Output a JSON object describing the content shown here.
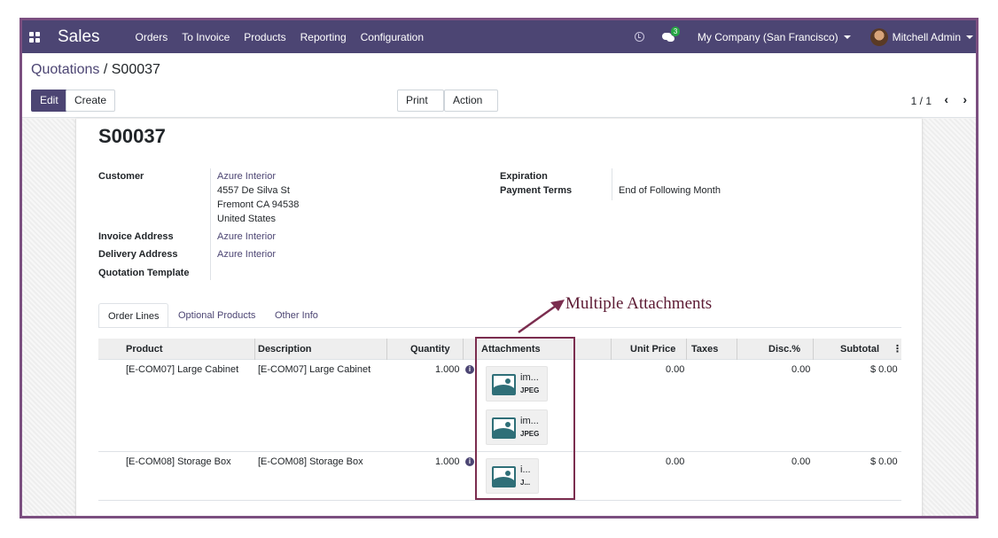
{
  "navbar": {
    "app_title": "Sales",
    "menu": [
      "Orders",
      "To Invoice",
      "Products",
      "Reporting",
      "Configuration"
    ],
    "chat_badge": "3",
    "company": "My Company (San Francisco)",
    "user": "Mitchell Admin",
    "background": "#4c4573"
  },
  "breadcrumb": {
    "parent": "Quotations",
    "separator": "/",
    "current": "S00037"
  },
  "buttons": {
    "edit": "Edit",
    "create": "Create",
    "print": "Print",
    "action": "Action"
  },
  "pager": {
    "text": "1 / 1"
  },
  "record": {
    "name": "S00037",
    "customer_label": "Customer",
    "customer_name": "Azure Interior",
    "address_line1": "4557 De Silva St",
    "address_line2": "Fremont CA 94538",
    "address_line3": "United States",
    "invoice_address_label": "Invoice Address",
    "invoice_address": "Azure Interior",
    "delivery_address_label": "Delivery Address",
    "delivery_address": "Azure Interior",
    "quotation_template_label": "Quotation Template",
    "expiration_label": "Expiration",
    "payment_terms_label": "Payment Terms",
    "payment_terms": "End of Following Month"
  },
  "tabs": [
    "Order Lines",
    "Optional Products",
    "Other Info"
  ],
  "table": {
    "headers": {
      "product": "Product",
      "description": "Description",
      "quantity": "Quantity",
      "attachments": "Attachments",
      "unit_price": "Unit Price",
      "taxes": "Taxes",
      "discount": "Disc.%",
      "subtotal": "Subtotal"
    },
    "rows": [
      {
        "product": "[E-COM07] Large Cabinet",
        "description": "[E-COM07] Large Cabinet",
        "quantity": "1.000",
        "attachments": [
          {
            "name": "im...",
            "type": "JPEG"
          },
          {
            "name": "im...",
            "type": "JPEG"
          }
        ],
        "unit_price": "0.00",
        "discount": "0.00",
        "subtotal": "$ 0.00"
      },
      {
        "product": "[E-COM08] Storage Box",
        "description": "[E-COM08] Storage Box",
        "quantity": "1.000",
        "attachments": [
          {
            "name": "i...",
            "type": "J..."
          }
        ],
        "unit_price": "0.00",
        "discount": "0.00",
        "subtotal": "$ 0.00"
      }
    ]
  },
  "annotation": {
    "text": "Multiple Attachments",
    "color": "#7b2d4f"
  }
}
